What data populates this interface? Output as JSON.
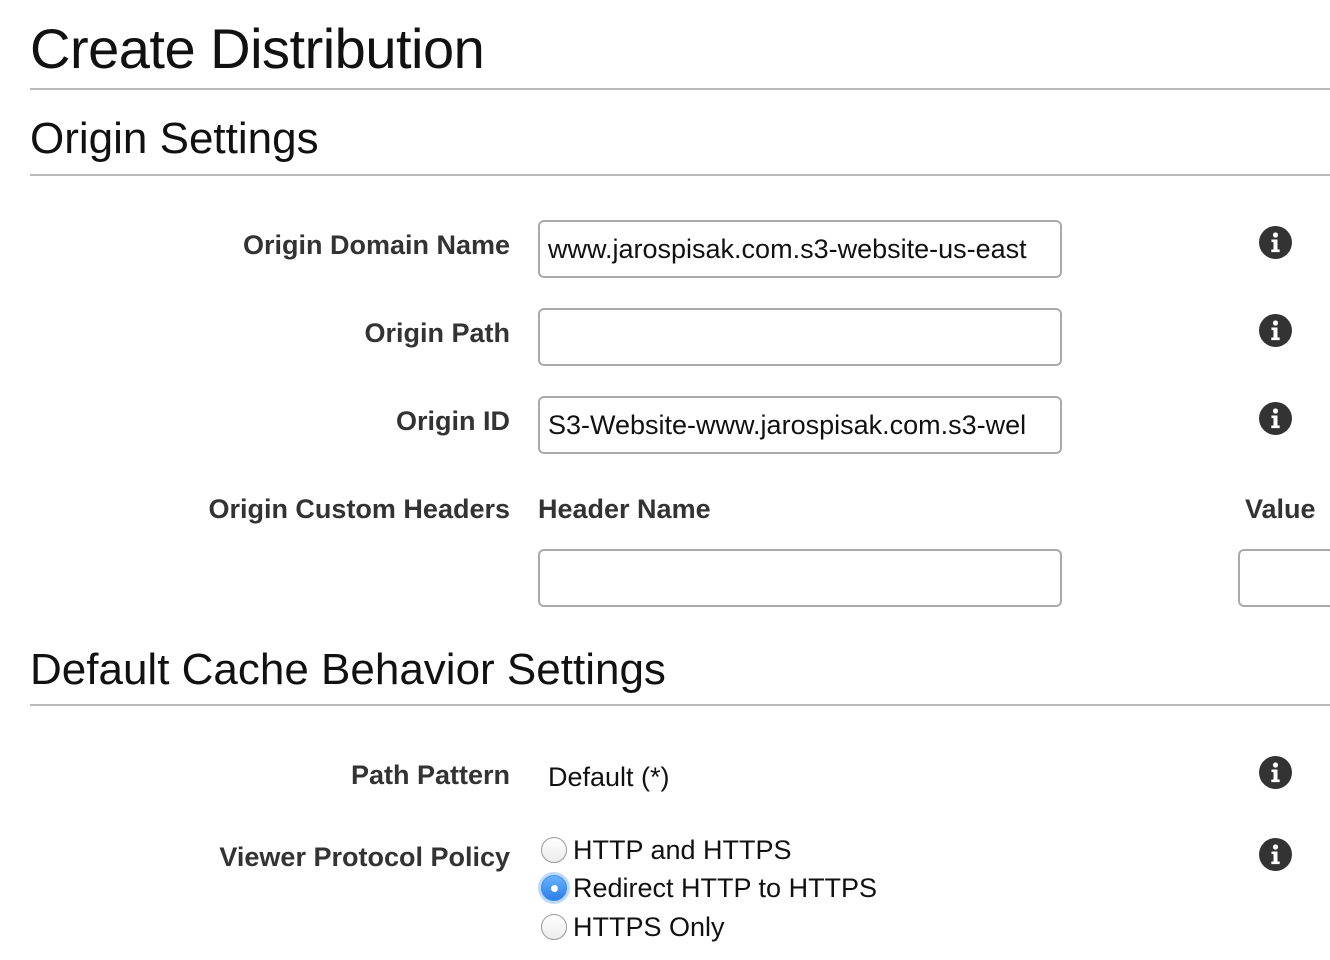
{
  "page": {
    "title": "Create Distribution"
  },
  "origin_settings": {
    "title": "Origin Settings",
    "domain_name": {
      "label": "Origin Domain Name",
      "value": "www.jarospisak.com.s3-website-us-east"
    },
    "path": {
      "label": "Origin Path",
      "value": ""
    },
    "origin_id": {
      "label": "Origin ID",
      "value": "S3-Website-www.jarospisak.com.s3-wel"
    },
    "custom_headers": {
      "label": "Origin Custom Headers",
      "header_name_label": "Header Name",
      "value_label": "Value",
      "header_name_value": "",
      "value_value": ""
    }
  },
  "cache_behavior": {
    "title": "Default Cache Behavior Settings",
    "path_pattern": {
      "label": "Path Pattern",
      "value": "Default (*)"
    },
    "viewer_protocol_policy": {
      "label": "Viewer Protocol Policy",
      "options": [
        {
          "label": "HTTP and HTTPS",
          "selected": false
        },
        {
          "label": "Redirect HTTP to HTTPS",
          "selected": true
        },
        {
          "label": "HTTPS Only",
          "selected": false
        }
      ]
    }
  },
  "icons": {
    "info": "info-icon"
  },
  "colors": {
    "rule": "#b9b9b9",
    "label_text": "#333333",
    "radio_selected": "#2a7ee8",
    "info_icon": "#333333"
  }
}
